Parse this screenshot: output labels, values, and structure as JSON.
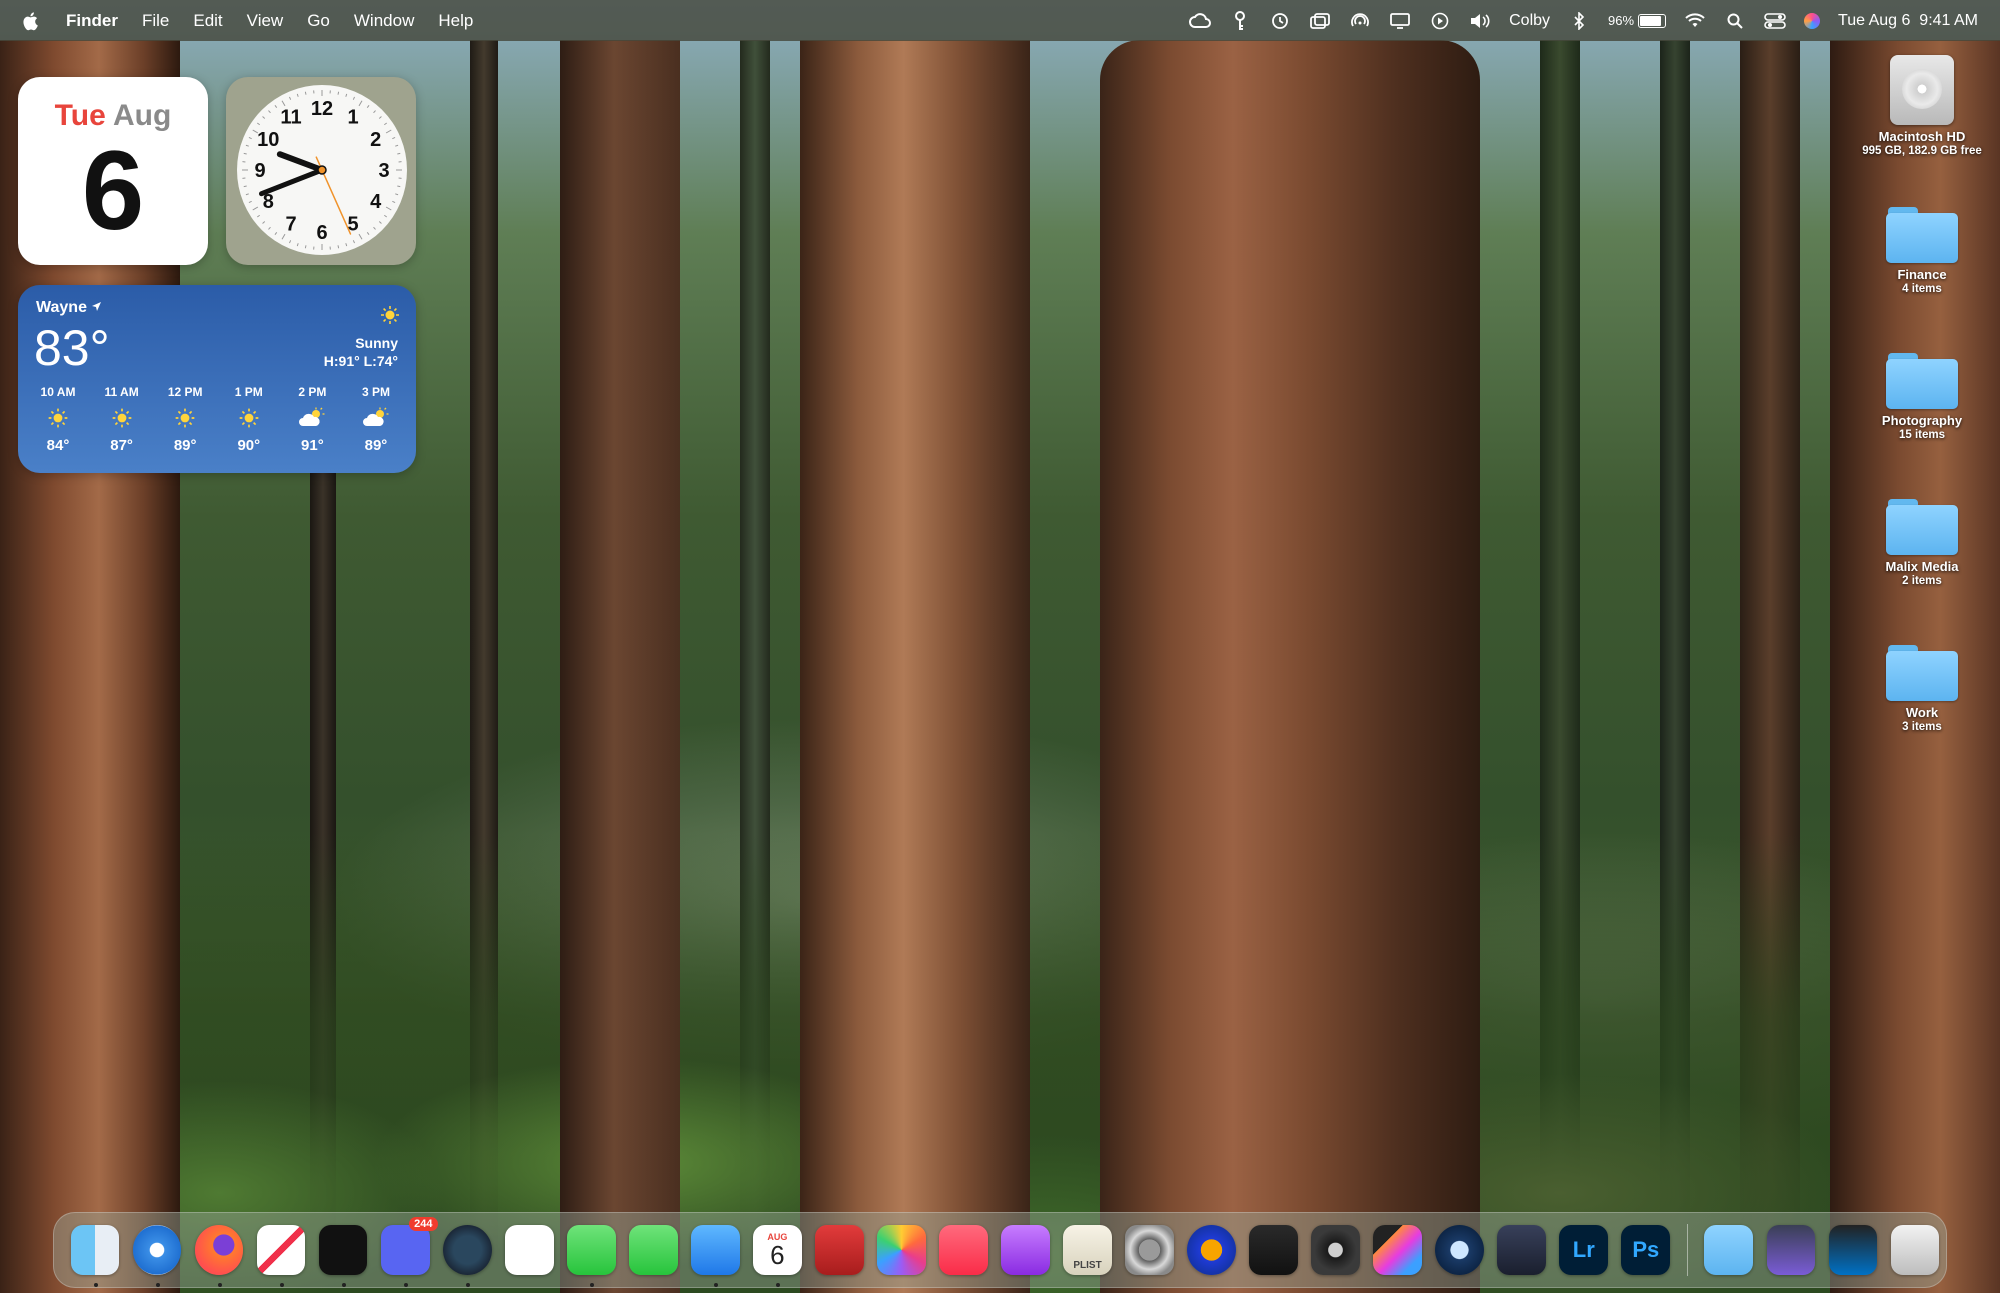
{
  "menubar": {
    "app_name": "Finder",
    "menus": [
      "File",
      "Edit",
      "View",
      "Go",
      "Window",
      "Help"
    ],
    "user": "Colby",
    "battery_percent": "96%",
    "battery_level": 0.96,
    "datetime": "Tue Aug 6  9:41 AM"
  },
  "calendar_widget": {
    "day_of_week": "Tue",
    "month": "Aug",
    "day": "6"
  },
  "clock_widget": {
    "numbers": [
      "12",
      "1",
      "2",
      "3",
      "4",
      "5",
      "6",
      "7",
      "8",
      "9",
      "10",
      "11"
    ],
    "hour": 9,
    "minute": 41,
    "second": 26
  },
  "weather_widget": {
    "city": "Wayne",
    "temperature": "83°",
    "condition": "Sunny",
    "hi_lo": "H:91° L:74°",
    "hourly": [
      {
        "time": "10 AM",
        "temp": "84°",
        "icon": "sun-icon"
      },
      {
        "time": "11 AM",
        "temp": "87°",
        "icon": "sun-icon"
      },
      {
        "time": "12 PM",
        "temp": "89°",
        "icon": "sun-icon"
      },
      {
        "time": "1 PM",
        "temp": "90°",
        "icon": "sun-icon"
      },
      {
        "time": "2 PM",
        "temp": "91°",
        "icon": "partly-cloudy-icon"
      },
      {
        "time": "3 PM",
        "temp": "89°",
        "icon": "partly-cloudy-icon"
      }
    ]
  },
  "desktop_icons": [
    {
      "label": "Macintosh HD",
      "sub": "995 GB, 182.9 GB free",
      "type": "drive"
    },
    {
      "label": "Finance",
      "sub": "4 items",
      "type": "folder"
    },
    {
      "label": "Photography",
      "sub": "15 items",
      "type": "folder"
    },
    {
      "label": "Malix Media",
      "sub": "2 items",
      "type": "folder"
    },
    {
      "label": "Work",
      "sub": "3 items",
      "type": "folder"
    }
  ],
  "dock": {
    "apps": [
      {
        "name": "finder",
        "running": true
      },
      {
        "name": "safari",
        "running": true
      },
      {
        "name": "firefox",
        "running": true
      },
      {
        "name": "news",
        "running": true
      },
      {
        "name": "stocks",
        "running": true
      },
      {
        "name": "discord",
        "running": true,
        "badge": "244"
      },
      {
        "name": "steam",
        "running": true
      },
      {
        "name": "layers-app",
        "running": false
      },
      {
        "name": "messages",
        "running": true
      },
      {
        "name": "facetime",
        "running": false
      },
      {
        "name": "mail",
        "running": true
      },
      {
        "name": "calendar",
        "running": true,
        "month": "AUG",
        "day": "6"
      },
      {
        "name": "photo-booth",
        "running": false
      },
      {
        "name": "photos",
        "running": false
      },
      {
        "name": "music",
        "running": false
      },
      {
        "name": "podcasts",
        "running": false
      },
      {
        "name": "plist-editor",
        "running": false,
        "text": "PLIST"
      },
      {
        "name": "system-settings",
        "running": false
      },
      {
        "name": "audacity",
        "running": false
      },
      {
        "name": "garageband",
        "running": false
      },
      {
        "name": "compressor",
        "running": false
      },
      {
        "name": "final-cut-pro",
        "running": false
      },
      {
        "name": "quicktime",
        "running": false
      },
      {
        "name": "davinci-resolve",
        "running": false
      },
      {
        "name": "lightroom",
        "running": false,
        "text": "Lr"
      },
      {
        "name": "photoshop",
        "running": false,
        "text": "Ps"
      }
    ],
    "stack_items": [
      "downloads-folder",
      "screenshot-stack",
      "intel-stack",
      "trash"
    ]
  }
}
